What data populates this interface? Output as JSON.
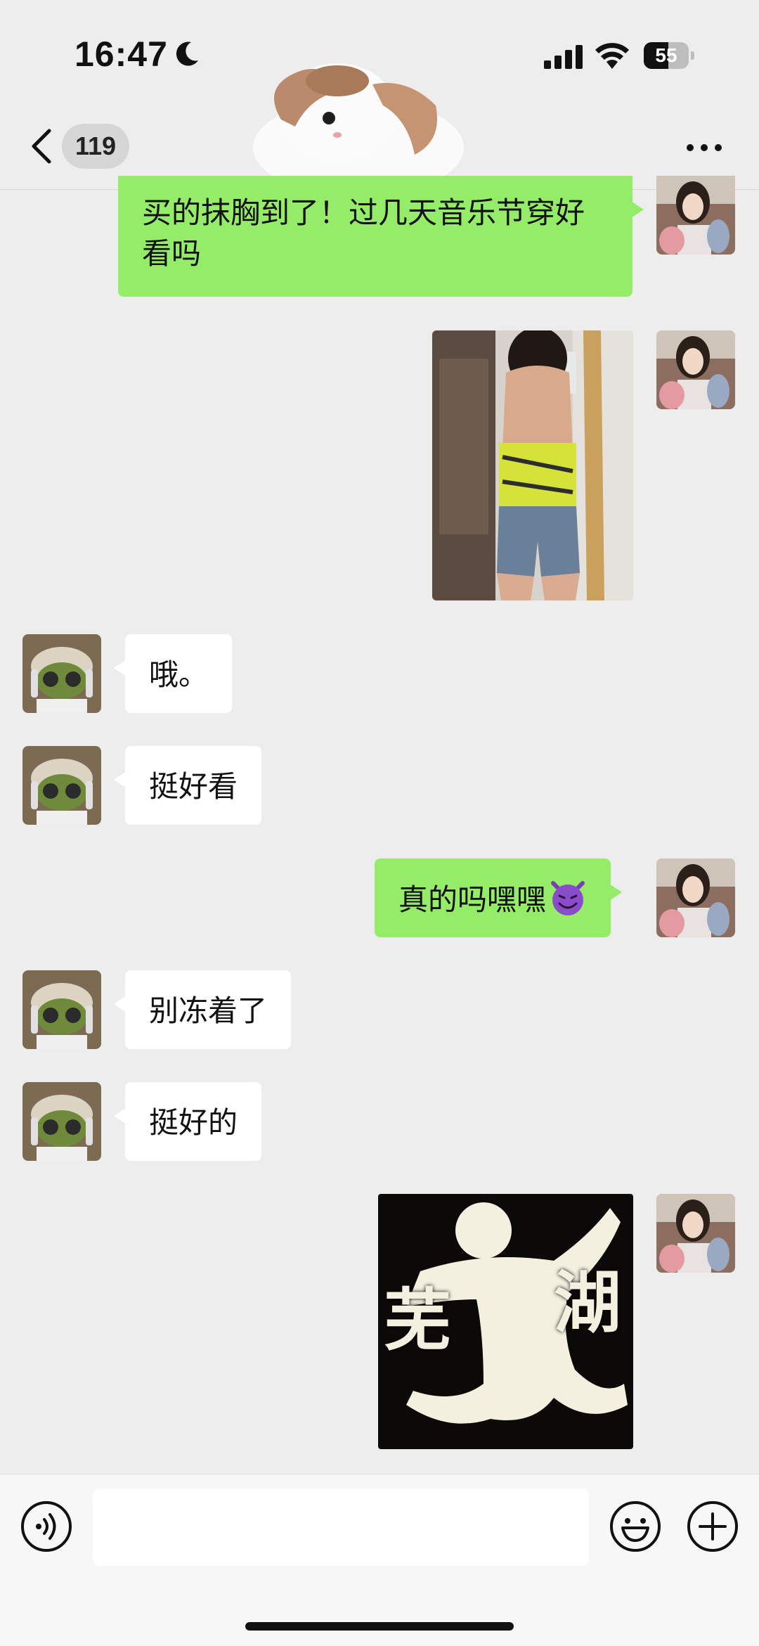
{
  "status_bar": {
    "time": "16:47",
    "battery_level": "55",
    "icons": [
      "moon-icon",
      "signal-icon",
      "wifi-icon",
      "battery-icon"
    ]
  },
  "nav": {
    "unread_count": "119",
    "icons": [
      "back-chevron-icon",
      "more-icon"
    ]
  },
  "messages": [
    {
      "side": "out",
      "type": "text",
      "text": "买的抹胸到了！过几天音乐节穿好看吗"
    },
    {
      "side": "out",
      "type": "image",
      "content": "outfit-photo"
    },
    {
      "side": "in",
      "type": "text",
      "text": "哦。"
    },
    {
      "side": "in",
      "type": "text",
      "text": "挺好看"
    },
    {
      "side": "out",
      "type": "text",
      "text": "真的吗嘿嘿",
      "emoji": "smiling-devil-emoji"
    },
    {
      "side": "in",
      "type": "text",
      "text": "别冻着了"
    },
    {
      "side": "in",
      "type": "text",
      "text": "挺好的"
    },
    {
      "side": "out",
      "type": "image",
      "content": "sticker",
      "sticker_text_left": "芜",
      "sticker_text_right": "湖"
    }
  ],
  "input_bar": {
    "text_value": "",
    "icons": [
      "voice-icon",
      "emoji-icon",
      "plus-icon"
    ]
  },
  "colors": {
    "background": "#ededed",
    "outgoing_bubble": "#95ec69",
    "incoming_bubble": "#ffffff"
  }
}
